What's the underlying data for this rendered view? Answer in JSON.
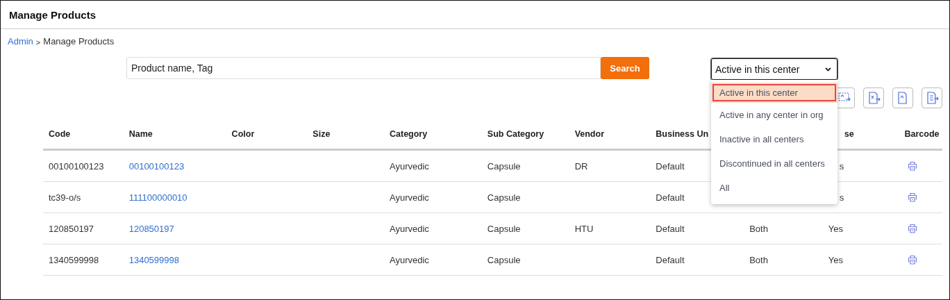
{
  "header": {
    "title": "Manage Products"
  },
  "breadcrumb": {
    "link": "Admin",
    "separator": ">",
    "current": "Manage Products"
  },
  "search": {
    "placeholder": "Product name, Tag",
    "button": "Search"
  },
  "status_filter": {
    "value": "Active in this center",
    "expanded": true,
    "options": [
      {
        "label": "Active in this center",
        "selected": true
      },
      {
        "label": "Active in any center in org",
        "selected": false
      },
      {
        "label": "Inactive in all centers",
        "selected": false
      },
      {
        "label": "Discontinued in all centers",
        "selected": false
      },
      {
        "label": "All",
        "selected": false
      }
    ]
  },
  "table": {
    "columns": [
      "Code",
      "Name",
      "Color",
      "Size",
      "Category",
      "Sub Category",
      "Vendor",
      "Business Un",
      null,
      {
        "text": "se",
        "partial": true
      },
      "Barcode"
    ],
    "rows": [
      [
        "00100100123",
        "00100100123",
        null,
        null,
        "Ayurvedic",
        "Capsule",
        "DR",
        "Default",
        null,
        {
          "text": "s",
          "partial": true
        }
      ],
      [
        "tc39-o/s",
        "111100000010",
        null,
        null,
        "Ayurvedic",
        "Capsule",
        null,
        "Default",
        null,
        {
          "text": "s",
          "partial": true
        }
      ],
      [
        "120850197",
        "120850197",
        null,
        null,
        "Ayurvedic",
        "Capsule",
        "HTU",
        "Default",
        "Both",
        "Yes"
      ],
      [
        "1340599998",
        "1340599998",
        null,
        null,
        "Ayurvedic",
        "Capsule",
        null,
        "Default",
        "Both",
        "Yes"
      ]
    ]
  }
}
